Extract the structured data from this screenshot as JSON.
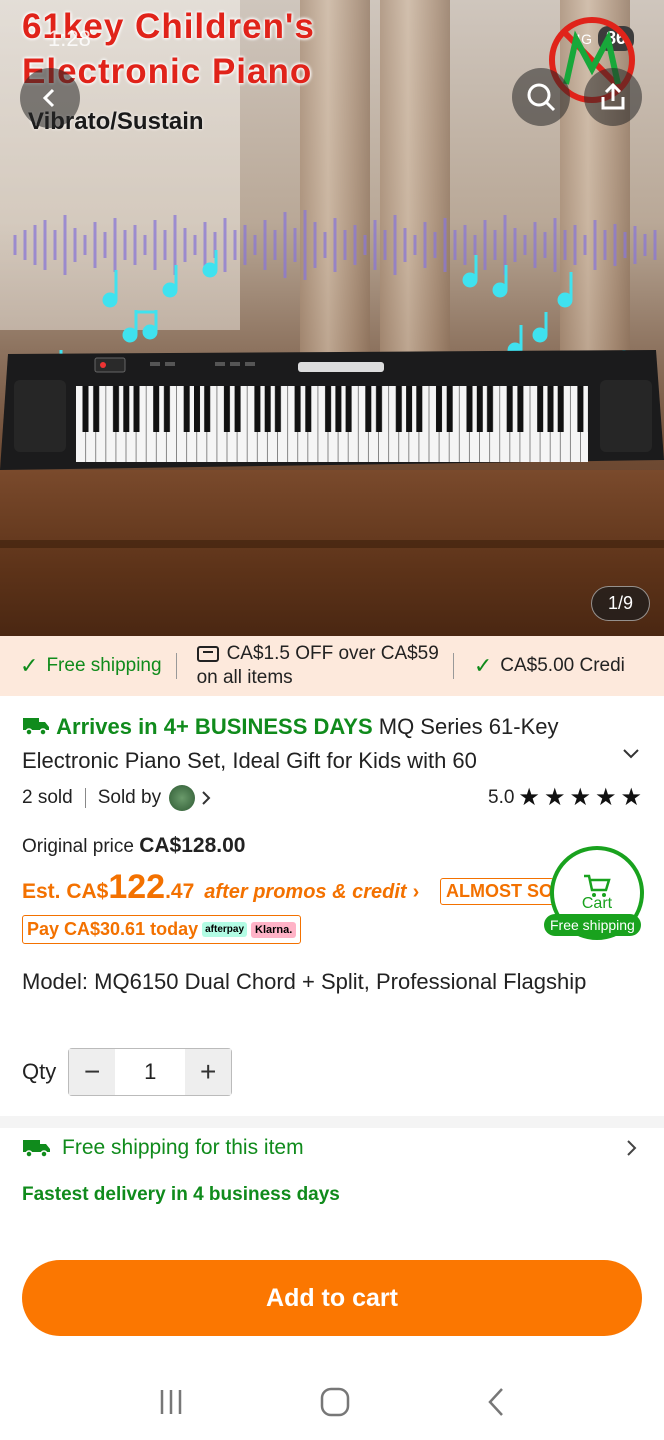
{
  "status_bar": {
    "time": "1:28",
    "network": "4G",
    "battery": "86"
  },
  "hero": {
    "title_line1": "61key Children's",
    "title_line2": "Electronic Piano",
    "subtitle": "Vibrato/Sustain",
    "image_counter": "1/9"
  },
  "promo_strip": {
    "item1": "Free shipping",
    "item2_line1": "CA$1.5 OFF over CA$59",
    "item2_line2": "on all items",
    "item3": "CA$5.00 Credi"
  },
  "product": {
    "arrives": "Arrives in 4+ BUSINESS DAYS",
    "title": "MQ Series 61-Key Electronic Piano Set, Ideal Gift for Kids with 60",
    "sold": "2 sold",
    "sold_by": "Sold by",
    "rating": "5.0",
    "stars": 5
  },
  "pricing": {
    "original_label": "Original price",
    "original_value": "CA$128.00",
    "est_prefix": "Est. CA$",
    "est_int": "122",
    "est_dec": ".47",
    "promo_link": "after promos & credit",
    "almost_badge": "ALMOST SOLD OUT",
    "pay_today": "Pay CA$30.61 today",
    "afterpay": "afterpay",
    "klarna": "Klarna."
  },
  "cart_float": {
    "label": "Cart",
    "badge": "Free shipping"
  },
  "model": "Model: MQ6150 Dual Chord + Split, Professional Flagship",
  "qty": {
    "label": "Qty",
    "value": "1",
    "minus": "−",
    "plus": "+"
  },
  "shipping": {
    "title": "Free shipping for this item",
    "fastest": "Fastest delivery in 4 business days"
  },
  "add_to_cart": "Add to cart",
  "colors": {
    "accent_orange": "#fb7701",
    "green": "#108b1c",
    "promo_bg": "#fde9dc"
  }
}
